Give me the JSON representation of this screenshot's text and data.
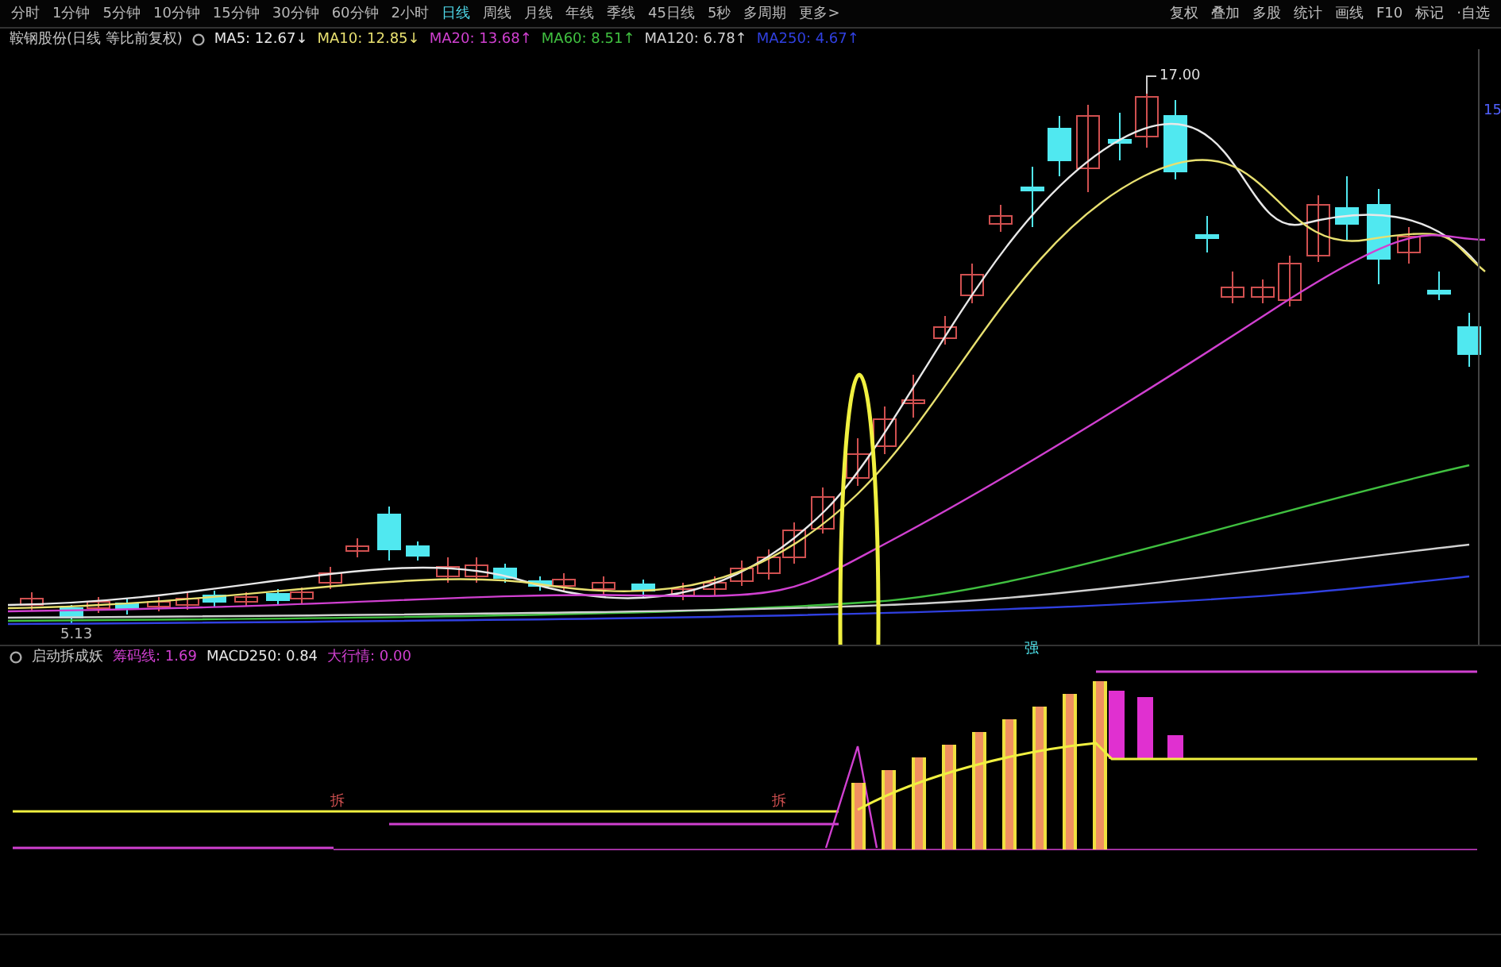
{
  "toolbar": {
    "periods": [
      {
        "label": "分时",
        "selected": false
      },
      {
        "label": "1分钟",
        "selected": false
      },
      {
        "label": "5分钟",
        "selected": false
      },
      {
        "label": "10分钟",
        "selected": false
      },
      {
        "label": "15分钟",
        "selected": false
      },
      {
        "label": "30分钟",
        "selected": false
      },
      {
        "label": "60分钟",
        "selected": false
      },
      {
        "label": "2小时",
        "selected": false
      },
      {
        "label": "日线",
        "selected": true
      },
      {
        "label": "周线",
        "selected": false
      },
      {
        "label": "月线",
        "selected": false
      },
      {
        "label": "年线",
        "selected": false
      },
      {
        "label": "季线",
        "selected": false
      },
      {
        "label": "45日线",
        "selected": false
      },
      {
        "label": "5秒",
        "selected": false
      },
      {
        "label": "多周期",
        "selected": false
      },
      {
        "label": "更多>",
        "selected": false
      }
    ],
    "tools": [
      "复权",
      "叠加",
      "多股",
      "统计",
      "画线",
      "F10",
      "标记",
      "·自选"
    ]
  },
  "main_chart": {
    "title": "鞍钢股份(日线 等比前复权)",
    "indicators": [
      {
        "label": "MA5: 12.67↓",
        "color": "#e8e8e8"
      },
      {
        "label": "MA10: 12.85↓",
        "color": "#e8e070"
      },
      {
        "label": "MA20: 13.68↑",
        "color": "#d040d0"
      },
      {
        "label": "MA60: 8.51↑",
        "color": "#40c040"
      },
      {
        "label": "MA120: 6.78↑",
        "color": "#d0d0d0"
      },
      {
        "label": "MA250: 4.67↑",
        "color": "#3040e0"
      }
    ],
    "high_label": "17.00",
    "low_label": "5.13",
    "scale_label": "15"
  },
  "sub_chart": {
    "title": "启动拆成妖",
    "indicators": [
      {
        "label": "筹码线: 1.69",
        "color": "#d040d0"
      },
      {
        "label": "MACD250: 0.84",
        "color": "#e8e8e8"
      },
      {
        "label": "大行情: 0.00",
        "color": "#d040d0"
      }
    ],
    "signals": [
      "拆",
      "拆",
      "强"
    ]
  }
}
